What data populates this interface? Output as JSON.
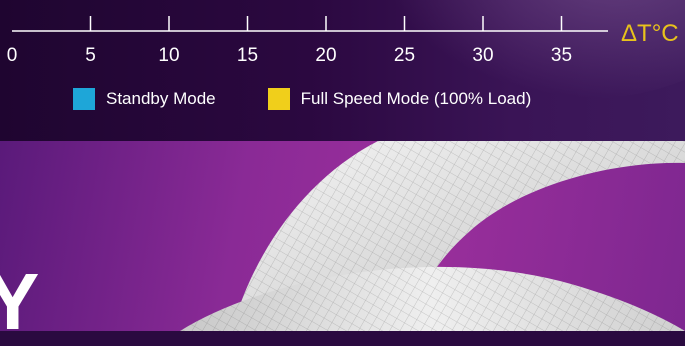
{
  "chart_data": {
    "type": "bar",
    "title": "",
    "xlabel": "ΔT°C",
    "ylabel": "",
    "xlim": [
      0,
      37
    ],
    "x_ticks": [
      "0",
      "5",
      "10",
      "15",
      "20",
      "25",
      "30",
      "35"
    ],
    "series": [
      {
        "name": "Standby Mode",
        "color": "#1ea6d8",
        "values": []
      },
      {
        "name": "Full Speed Mode (100% Load)",
        "color": "#f0cf1b",
        "values": []
      }
    ],
    "legend_position": "bottom"
  },
  "decor": {
    "partial_letter": "Y",
    "top_band_color": "#260738",
    "bottom_band_color": "#8e2b98"
  }
}
